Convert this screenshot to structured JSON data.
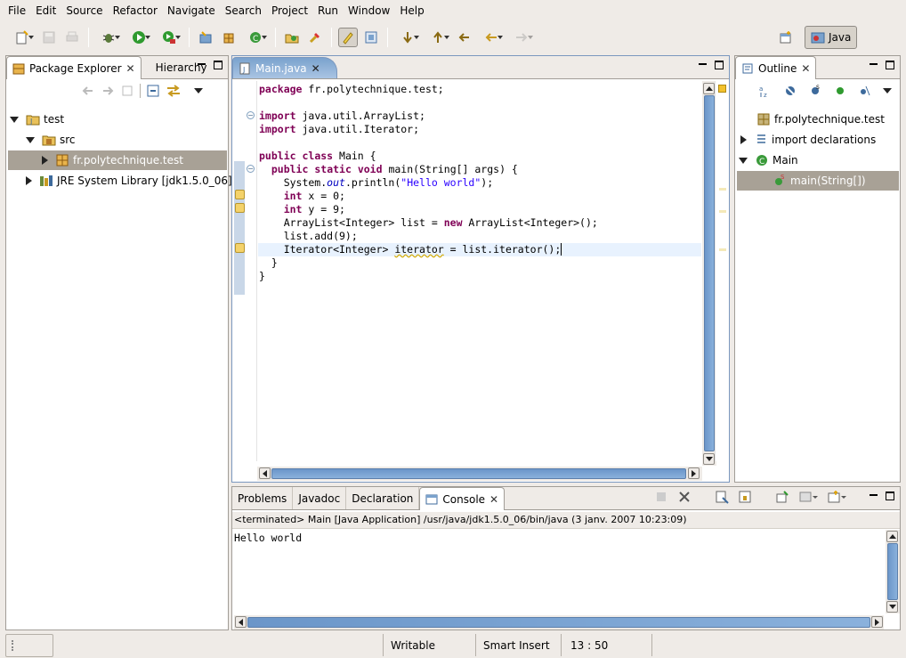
{
  "menu": [
    {
      "label": "File"
    },
    {
      "label": "Edit"
    },
    {
      "label": "Source"
    },
    {
      "label": "Refactor"
    },
    {
      "label": "Navigate"
    },
    {
      "label": "Search"
    },
    {
      "label": "Project"
    },
    {
      "label": "Run"
    },
    {
      "label": "Window"
    },
    {
      "label": "Help"
    }
  ],
  "perspective": {
    "label": "Java"
  },
  "package_explorer": {
    "tab_label": "Package Explorer",
    "tab2_label": "Hierarchy",
    "tree": [
      {
        "label": "test"
      },
      {
        "label": "src"
      },
      {
        "label": "fr.polytechnique.test"
      },
      {
        "label": "JRE System Library [jdk1.5.0_06]"
      }
    ]
  },
  "editor": {
    "tab_label": "Main.java",
    "lines": [
      "package fr.polytechnique.test;",
      "",
      "import java.util.ArrayList;",
      "import java.util.Iterator;",
      "",
      "public class Main {",
      "  public static void main(String[] args) {",
      "    System.out.println(\"Hello world\");",
      "    int x = 0;",
      "    int y = 9;",
      "    ArrayList<Integer> list = new ArrayList<Integer>();",
      "    list.add(9);",
      "    Iterator<Integer> iterator = list.iterator();",
      "  }",
      "}"
    ]
  },
  "outline": {
    "tab_label": "Outline",
    "tree": [
      {
        "label": "fr.polytechnique.test"
      },
      {
        "label": "import declarations"
      },
      {
        "label": "Main"
      },
      {
        "label": "main(String[])"
      }
    ]
  },
  "bottom": {
    "tabs": [
      {
        "label": "Problems"
      },
      {
        "label": "Javadoc"
      },
      {
        "label": "Declaration"
      },
      {
        "label": "Console"
      }
    ],
    "console_status": "<terminated> Main [Java Application] /usr/java/jdk1.5.0_06/bin/java (3 janv. 2007 10:23:09)",
    "console_output": "Hello world"
  },
  "statusbar": {
    "writable": "Writable",
    "insert_mode": "Smart Insert",
    "position": "13 : 50"
  },
  "colors": {
    "keyword": "#7f0055",
    "string": "#2a00ff",
    "selection": "#a8a196",
    "editor_tab": "#7aa2cd"
  }
}
